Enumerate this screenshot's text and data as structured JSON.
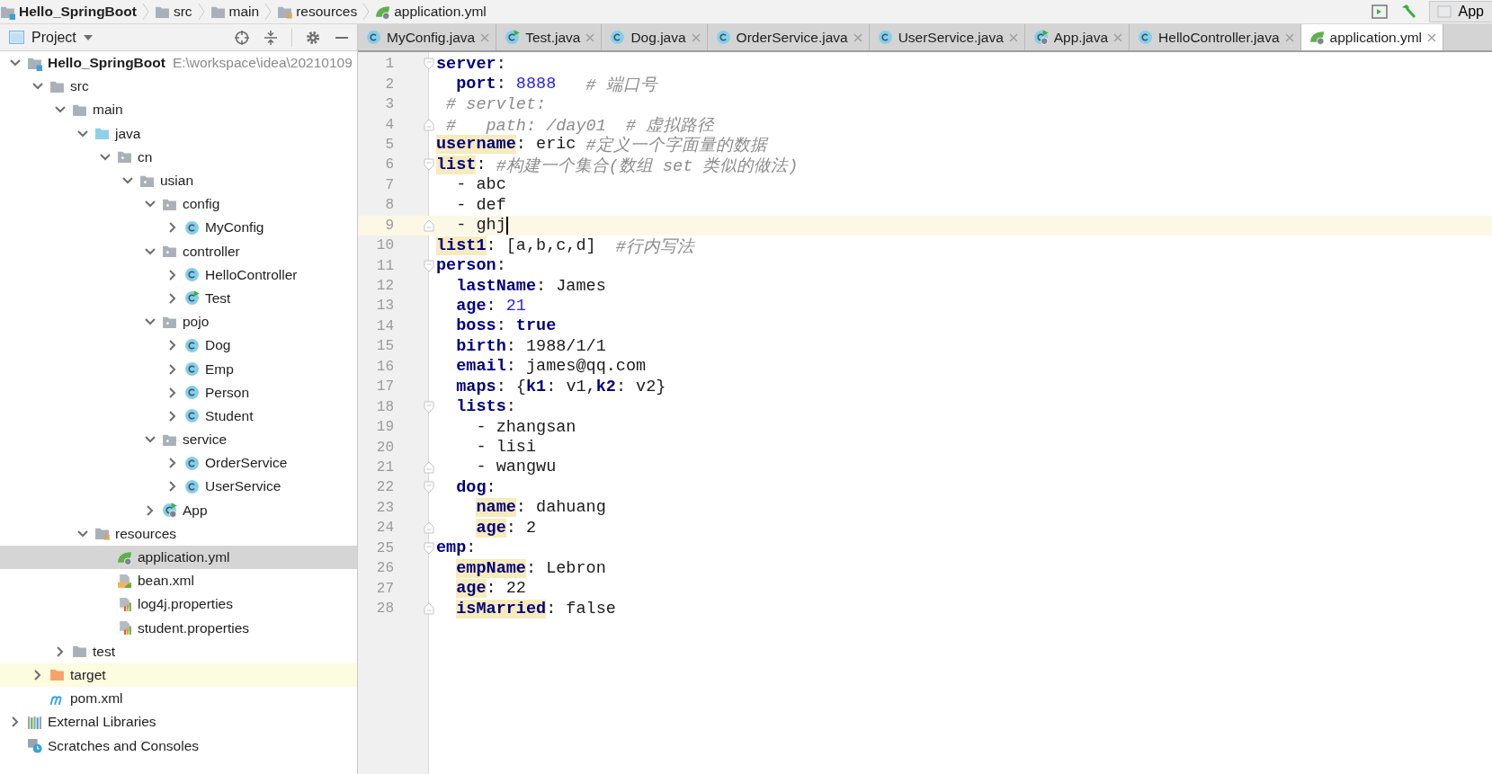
{
  "breadcrumb": [
    {
      "label": "Hello_SpringBoot",
      "kind": "module"
    },
    {
      "label": "src",
      "kind": "folder"
    },
    {
      "label": "main",
      "kind": "folder"
    },
    {
      "label": "resources",
      "kind": "resources"
    },
    {
      "label": "application.yml",
      "kind": "yml"
    }
  ],
  "run_config": {
    "label": "App"
  },
  "project": {
    "title": "Project",
    "tree": [
      {
        "label": "Hello_SpringBoot",
        "path": "E:\\workspace\\idea\\20210109",
        "kind": "module",
        "expanded": true,
        "selected": false,
        "marked": false,
        "children": [
          {
            "label": "src",
            "kind": "folder",
            "expanded": true,
            "selected": false,
            "marked": false,
            "children": [
              {
                "label": "main",
                "kind": "folder",
                "expanded": true,
                "selected": false,
                "marked": false,
                "children": [
                  {
                    "label": "java",
                    "kind": "source-folder",
                    "expanded": true,
                    "selected": false,
                    "marked": false,
                    "children": [
                      {
                        "label": "cn",
                        "kind": "package",
                        "expanded": true,
                        "selected": false,
                        "marked": false,
                        "children": [
                          {
                            "label": "usian",
                            "kind": "package",
                            "expanded": true,
                            "selected": false,
                            "marked": false,
                            "children": [
                              {
                                "label": "config",
                                "kind": "package",
                                "expanded": true,
                                "selected": false,
                                "marked": false,
                                "children": [
                                  {
                                    "label": "MyConfig",
                                    "kind": "class",
                                    "expanded": false,
                                    "selected": false,
                                    "marked": false
                                  }
                                ]
                              },
                              {
                                "label": "controller",
                                "kind": "package",
                                "expanded": true,
                                "selected": false,
                                "marked": false,
                                "children": [
                                  {
                                    "label": "HelloController",
                                    "kind": "class",
                                    "expanded": false,
                                    "selected": false,
                                    "marked": false
                                  },
                                  {
                                    "label": "Test",
                                    "kind": "test-class",
                                    "expanded": false,
                                    "selected": false,
                                    "marked": false
                                  }
                                ]
                              },
                              {
                                "label": "pojo",
                                "kind": "package",
                                "expanded": true,
                                "selected": false,
                                "marked": false,
                                "children": [
                                  {
                                    "label": "Dog",
                                    "kind": "class",
                                    "expanded": false,
                                    "selected": false,
                                    "marked": false
                                  },
                                  {
                                    "label": "Emp",
                                    "kind": "class",
                                    "expanded": false,
                                    "selected": false,
                                    "marked": false
                                  },
                                  {
                                    "label": "Person",
                                    "kind": "class",
                                    "expanded": false,
                                    "selected": false,
                                    "marked": false
                                  },
                                  {
                                    "label": "Student",
                                    "kind": "class",
                                    "expanded": false,
                                    "selected": false,
                                    "marked": false
                                  }
                                ]
                              },
                              {
                                "label": "service",
                                "kind": "package",
                                "expanded": true,
                                "selected": false,
                                "marked": false,
                                "children": [
                                  {
                                    "label": "OrderService",
                                    "kind": "class",
                                    "expanded": false,
                                    "selected": false,
                                    "marked": false
                                  },
                                  {
                                    "label": "UserService",
                                    "kind": "class",
                                    "expanded": false,
                                    "selected": false,
                                    "marked": false
                                  }
                                ]
                              },
                              {
                                "label": "App",
                                "kind": "spring-class",
                                "expanded": false,
                                "selected": false,
                                "marked": false
                              }
                            ]
                          }
                        ]
                      }
                    ]
                  },
                  {
                    "label": "resources",
                    "kind": "resources",
                    "expanded": true,
                    "selected": false,
                    "marked": false,
                    "children": [
                      {
                        "label": "application.yml",
                        "kind": "yml",
                        "selected": true,
                        "marked": false
                      },
                      {
                        "label": "bean.xml",
                        "kind": "xml",
                        "selected": false,
                        "marked": false
                      },
                      {
                        "label": "log4j.properties",
                        "kind": "properties",
                        "selected": false,
                        "marked": false
                      },
                      {
                        "label": "student.properties",
                        "kind": "properties",
                        "selected": false,
                        "marked": false
                      }
                    ]
                  }
                ]
              },
              {
                "label": "test",
                "kind": "folder",
                "expanded": false,
                "selected": false,
                "marked": false
              }
            ]
          },
          {
            "label": "target",
            "kind": "excluded-folder",
            "expanded": false,
            "selected": false,
            "marked": true
          },
          {
            "label": "pom.xml",
            "kind": "maven",
            "selected": false,
            "marked": false
          }
        ]
      },
      {
        "label": "External Libraries",
        "kind": "libraries",
        "expanded": false,
        "selected": false,
        "marked": false
      },
      {
        "label": "Scratches and Consoles",
        "kind": "scratches",
        "selected": false,
        "marked": false
      }
    ]
  },
  "tabs": [
    {
      "label": "MyConfig.java",
      "kind": "class",
      "selected": false
    },
    {
      "label": "Test.java",
      "kind": "test-class",
      "selected": false
    },
    {
      "label": "Dog.java",
      "kind": "class",
      "selected": false
    },
    {
      "label": "OrderService.java",
      "kind": "class",
      "selected": false
    },
    {
      "label": "UserService.java",
      "kind": "class",
      "selected": false
    },
    {
      "label": "App.java",
      "kind": "spring-class",
      "selected": false
    },
    {
      "label": "HelloController.java",
      "kind": "class",
      "selected": false
    },
    {
      "label": "application.yml",
      "kind": "yml",
      "selected": true
    }
  ],
  "editor": {
    "lines": [
      {
        "number": "1",
        "fold_start": true,
        "fold_end": false,
        "current": false,
        "tokens": [
          {
            "kind": "key",
            "text": "server"
          },
          {
            "kind": "plain",
            "text": ":"
          }
        ]
      },
      {
        "number": "2",
        "fold_start": false,
        "fold_end": false,
        "current": false,
        "tokens": [
          {
            "kind": "key",
            "text": "  port"
          },
          {
            "kind": "plain",
            "text": ": "
          },
          {
            "kind": "number",
            "text": "8888"
          },
          {
            "kind": "comment",
            "text": "   # 端口号"
          }
        ]
      },
      {
        "number": "3",
        "fold_start": false,
        "fold_end": false,
        "current": false,
        "tokens": [
          {
            "kind": "comment",
            "text": " # servlet:"
          }
        ]
      },
      {
        "number": "4",
        "fold_start": false,
        "fold_end": true,
        "current": false,
        "tokens": [
          {
            "kind": "comment",
            "text": " #   path: /day01  # 虚拟路径"
          }
        ]
      },
      {
        "number": "5",
        "fold_start": false,
        "fold_end": false,
        "current": false,
        "tokens": [
          {
            "kind": "mark-key",
            "text": "username"
          },
          {
            "kind": "plain",
            "text": ": eric "
          },
          {
            "kind": "comment",
            "text": "#定义一个字面量的数据"
          }
        ]
      },
      {
        "number": "6",
        "fold_start": true,
        "fold_end": false,
        "current": false,
        "tokens": [
          {
            "kind": "mark-key",
            "text": "list"
          },
          {
            "kind": "plain",
            "text": ": "
          },
          {
            "kind": "comment",
            "text": "#构建一个集合(数组 set 类似的做法)"
          }
        ]
      },
      {
        "number": "7",
        "fold_start": false,
        "fold_end": false,
        "current": false,
        "tokens": [
          {
            "kind": "plain",
            "text": "  - abc"
          }
        ]
      },
      {
        "number": "8",
        "fold_start": false,
        "fold_end": false,
        "current": false,
        "tokens": [
          {
            "kind": "plain",
            "text": "  - def"
          }
        ]
      },
      {
        "number": "9",
        "fold_start": false,
        "fold_end": true,
        "current": true,
        "tokens": [
          {
            "kind": "plain",
            "text": "  - ghj"
          }
        ]
      },
      {
        "number": "10",
        "fold_start": false,
        "fold_end": false,
        "current": false,
        "tokens": [
          {
            "kind": "mark-key",
            "text": "list1"
          },
          {
            "kind": "plain",
            "text": ": [a,b,c,d]  "
          },
          {
            "kind": "comment",
            "text": "#行内写法"
          }
        ]
      },
      {
        "number": "11",
        "fold_start": true,
        "fold_end": false,
        "current": false,
        "tokens": [
          {
            "kind": "key",
            "text": "person"
          },
          {
            "kind": "plain",
            "text": ":"
          }
        ]
      },
      {
        "number": "12",
        "fold_start": false,
        "fold_end": false,
        "current": false,
        "tokens": [
          {
            "kind": "key",
            "text": "  lastName"
          },
          {
            "kind": "plain",
            "text": ": James"
          }
        ]
      },
      {
        "number": "13",
        "fold_start": false,
        "fold_end": false,
        "current": false,
        "tokens": [
          {
            "kind": "key",
            "text": "  age"
          },
          {
            "kind": "plain",
            "text": ": "
          },
          {
            "kind": "number",
            "text": "21"
          }
        ]
      },
      {
        "number": "14",
        "fold_start": false,
        "fold_end": false,
        "current": false,
        "tokens": [
          {
            "kind": "key",
            "text": "  boss"
          },
          {
            "kind": "plain",
            "text": ": "
          },
          {
            "kind": "key",
            "text": "true"
          }
        ]
      },
      {
        "number": "15",
        "fold_start": false,
        "fold_end": false,
        "current": false,
        "tokens": [
          {
            "kind": "key",
            "text": "  birth"
          },
          {
            "kind": "plain",
            "text": ": 1988/1/1"
          }
        ]
      },
      {
        "number": "16",
        "fold_start": false,
        "fold_end": false,
        "current": false,
        "tokens": [
          {
            "kind": "key",
            "text": "  email"
          },
          {
            "kind": "plain",
            "text": ": james@qq.com"
          }
        ]
      },
      {
        "number": "17",
        "fold_start": false,
        "fold_end": false,
        "current": false,
        "tokens": [
          {
            "kind": "key",
            "text": "  maps"
          },
          {
            "kind": "plain",
            "text": ": {"
          },
          {
            "kind": "key",
            "text": "k1"
          },
          {
            "kind": "plain",
            "text": ": v1,"
          },
          {
            "kind": "key",
            "text": "k2"
          },
          {
            "kind": "plain",
            "text": ": v2}"
          }
        ]
      },
      {
        "number": "18",
        "fold_start": true,
        "fold_end": false,
        "current": false,
        "tokens": [
          {
            "kind": "key",
            "text": "  lists"
          },
          {
            "kind": "plain",
            "text": ":"
          }
        ]
      },
      {
        "number": "19",
        "fold_start": false,
        "fold_end": false,
        "current": false,
        "tokens": [
          {
            "kind": "plain",
            "text": "    - zhangsan"
          }
        ]
      },
      {
        "number": "20",
        "fold_start": false,
        "fold_end": false,
        "current": false,
        "tokens": [
          {
            "kind": "plain",
            "text": "    - lisi"
          }
        ]
      },
      {
        "number": "21",
        "fold_start": false,
        "fold_end": true,
        "current": false,
        "tokens": [
          {
            "kind": "plain",
            "text": "    - wangwu"
          }
        ]
      },
      {
        "number": "22",
        "fold_start": true,
        "fold_end": false,
        "current": false,
        "tokens": [
          {
            "kind": "key",
            "text": "  dog"
          },
          {
            "kind": "plain",
            "text": ":"
          }
        ]
      },
      {
        "number": "23",
        "fold_start": false,
        "fold_end": false,
        "current": false,
        "tokens": [
          {
            "kind": "mark-key",
            "text": "    name"
          },
          {
            "kind": "plain",
            "text": ": dahuang"
          }
        ]
      },
      {
        "number": "24",
        "fold_start": false,
        "fold_end": true,
        "current": false,
        "tokens": [
          {
            "kind": "mark-key",
            "text": "    age"
          },
          {
            "kind": "plain",
            "text": ": 2"
          }
        ]
      },
      {
        "number": "25",
        "fold_start": true,
        "fold_end": false,
        "current": false,
        "tokens": [
          {
            "kind": "key",
            "text": "emp"
          },
          {
            "kind": "plain",
            "text": ":"
          }
        ]
      },
      {
        "number": "26",
        "fold_start": false,
        "fold_end": false,
        "current": false,
        "tokens": [
          {
            "kind": "mark-key",
            "text": "  empName"
          },
          {
            "kind": "plain",
            "text": ": Lebron"
          }
        ]
      },
      {
        "number": "27",
        "fold_start": false,
        "fold_end": false,
        "current": false,
        "tokens": [
          {
            "kind": "mark-key",
            "text": "  age"
          },
          {
            "kind": "plain",
            "text": ": 22"
          }
        ]
      },
      {
        "number": "28",
        "fold_start": false,
        "fold_end": true,
        "current": false,
        "tokens": [
          {
            "kind": "mark-key",
            "text": "  isMarried"
          },
          {
            "kind": "plain",
            "text": ": false"
          }
        ]
      }
    ]
  }
}
